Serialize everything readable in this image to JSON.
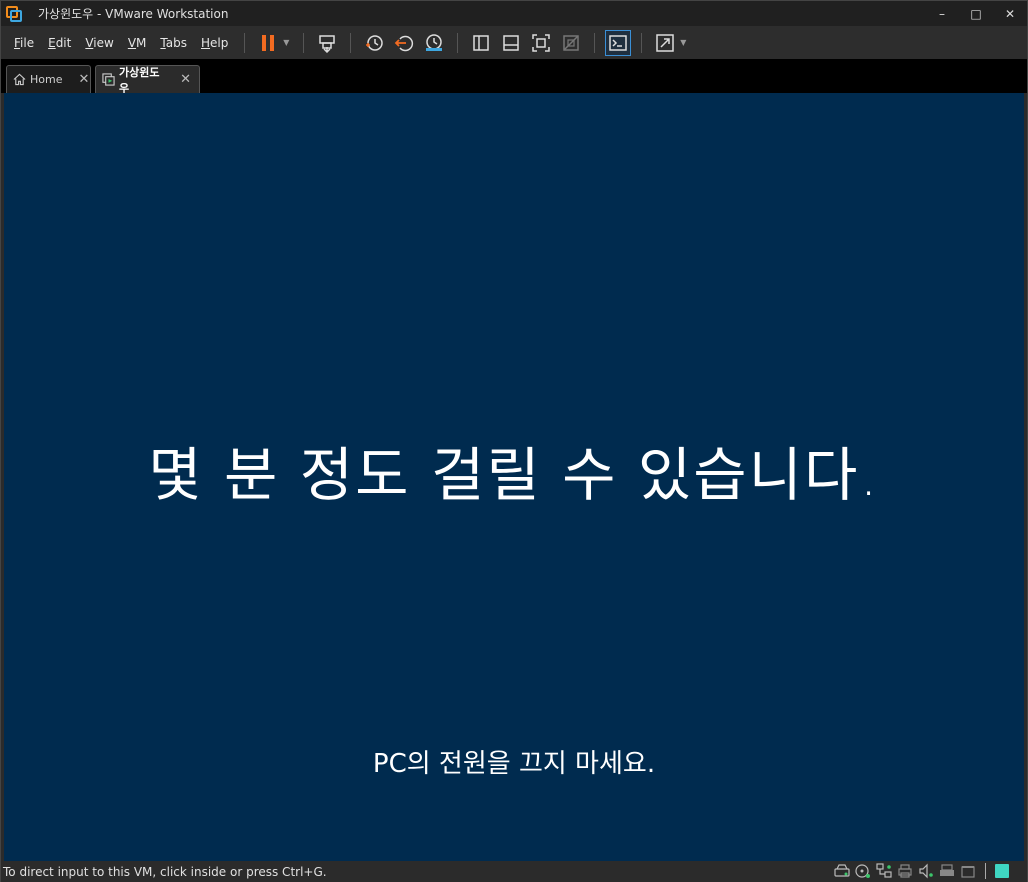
{
  "window": {
    "title": "가상윈도우 - VMware Workstation",
    "controls": {
      "minimize": "–",
      "maximize": "□",
      "close": "✕"
    }
  },
  "menu": {
    "items": [
      {
        "label": "File",
        "underline": "F",
        "rest": "ile"
      },
      {
        "label": "Edit",
        "underline": "E",
        "rest": "dit"
      },
      {
        "label": "View",
        "underline": "V",
        "rest": "iew"
      },
      {
        "label": "VM",
        "underline": "V",
        "rest": "M"
      },
      {
        "label": "Tabs",
        "underline": "T",
        "rest": "abs"
      },
      {
        "label": "Help",
        "underline": "H",
        "rest": "elp"
      }
    ]
  },
  "toolbar": {
    "icons": [
      "pause-icon",
      "send-ctrl-alt-del-icon",
      "snapshot-icon",
      "revert-snapshot-icon",
      "snapshot-manager-icon",
      "show-library-icon",
      "thumbnail-bar-icon",
      "full-screen-icon",
      "unity-icon",
      "console-view-icon",
      "stretch-guest-icon"
    ],
    "accent_pause": "#f26b21",
    "accent_console": "#3a8fd6"
  },
  "tabs": [
    {
      "label": "Home",
      "icon": "home-icon",
      "selected": false
    },
    {
      "label": "가상윈도우",
      "icon": "vm-icon",
      "selected": true
    }
  ],
  "vm": {
    "background": "#002b4f",
    "main_message": "몇 분 정도 걸릴 수 있습니다.",
    "sub_message": "PC의 전원을 끄지 마세요."
  },
  "status": {
    "text": "To direct input to this VM, click inside or press Ctrl+G.",
    "device_icons": [
      "hard-disk-icon",
      "cd-dvd-icon",
      "network-adapter-icon",
      "printer-icon",
      "sound-card-icon",
      "usb-printer-icon",
      "display-icon",
      "message-log-icon"
    ]
  }
}
